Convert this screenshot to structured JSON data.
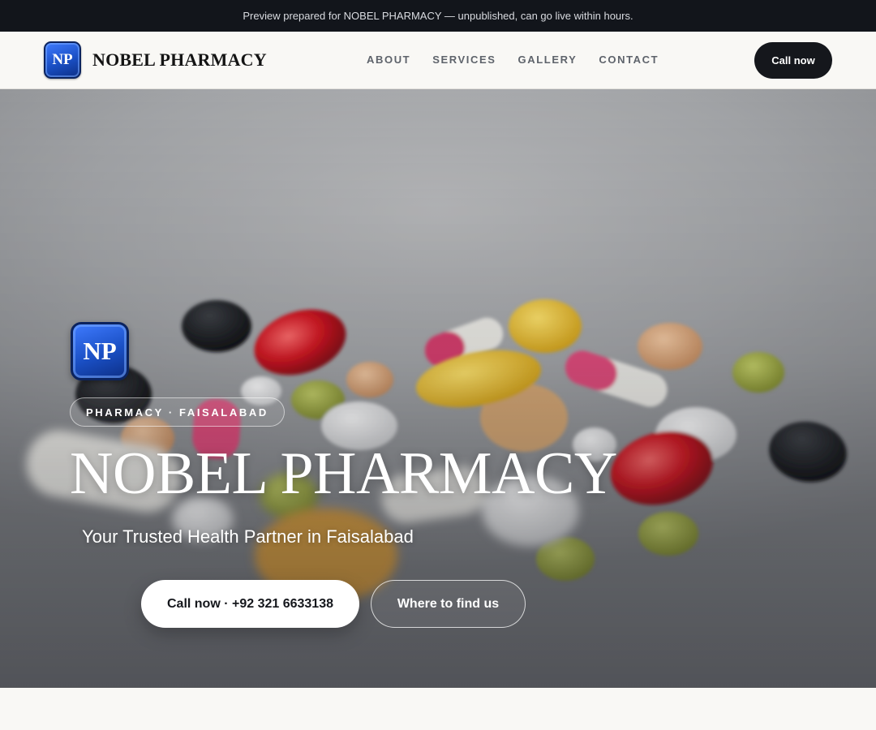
{
  "preview_banner": {
    "text": "Preview prepared for NOBEL PHARMACY — unpublished, can go live within hours."
  },
  "header": {
    "logo_initials": "NP",
    "brand_name": "NOBEL PHARMACY",
    "nav": [
      {
        "label": "ABOUT"
      },
      {
        "label": "SERVICES"
      },
      {
        "label": "GALLERY"
      },
      {
        "label": "CONTACT"
      }
    ],
    "cta_label": "Call now"
  },
  "hero": {
    "logo_initials": "NP",
    "eyebrow": "PHARMACY · FAISALABAD",
    "title": "NOBEL PHARMACY",
    "subtitle": "Your Trusted Health Partner in Faisalabad",
    "primary_button": "Call now · +92 321 6633138",
    "secondary_button": "Where to find us",
    "background_image": "pills-and-capsules-photo"
  },
  "colors": {
    "banner_bg": "#12151b",
    "header_bg": "#f9f8f5",
    "dark_button": "#15171c",
    "logo_blue": "#1a4fc4"
  }
}
